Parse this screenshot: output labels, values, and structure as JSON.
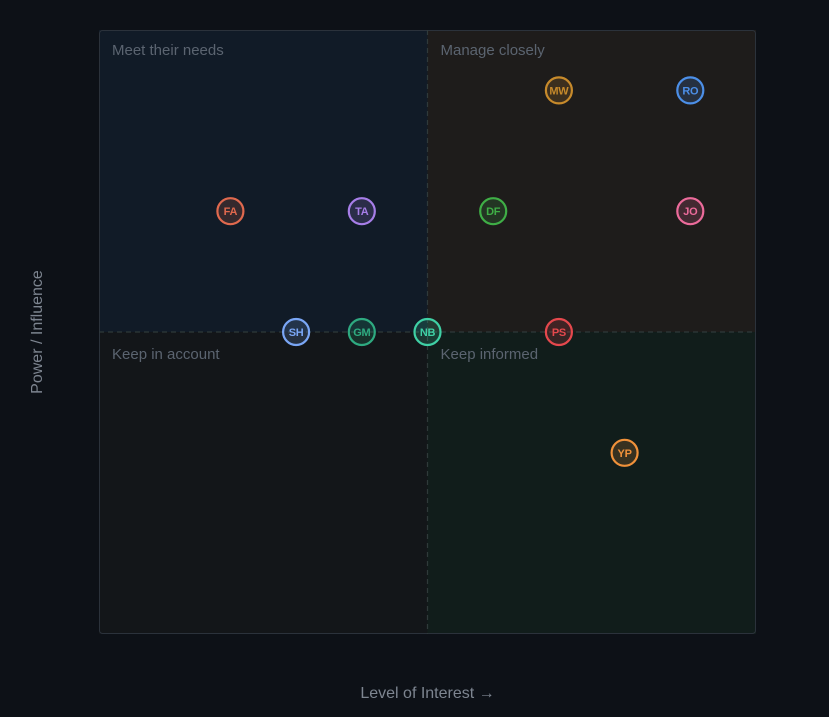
{
  "chart_data": {
    "type": "scatter",
    "xlabel": "Level of Interest →",
    "ylabel": "Power / Influence",
    "xlim": [
      0,
      5
    ],
    "ylim": [
      0,
      5
    ],
    "quadrants": {
      "top_left": {
        "label": "Meet their needs",
        "fill": "#111b27"
      },
      "top_right": {
        "label": "Manage closely",
        "fill": "#1e1c1b"
      },
      "bottom_left": {
        "label": "Keep in account",
        "fill": "#131619"
      },
      "bottom_right": {
        "label": "Keep informed",
        "fill": "#111d1b"
      }
    },
    "points": [
      {
        "initials": "MW",
        "x": 3.5,
        "y": 4.5,
        "color": "#c78a2b"
      },
      {
        "initials": "RO",
        "x": 4.5,
        "y": 4.5,
        "color": "#4c8fe8"
      },
      {
        "initials": "FA",
        "x": 1.0,
        "y": 3.5,
        "color": "#e0694e"
      },
      {
        "initials": "TA",
        "x": 2.0,
        "y": 3.5,
        "color": "#a77ee8"
      },
      {
        "initials": "DF",
        "x": 3.0,
        "y": 3.5,
        "color": "#3fae46"
      },
      {
        "initials": "JO",
        "x": 4.5,
        "y": 3.5,
        "color": "#ec6b9b"
      },
      {
        "initials": "SH",
        "x": 1.5,
        "y": 2.5,
        "color": "#7aa6f5"
      },
      {
        "initials": "GM",
        "x": 2.0,
        "y": 2.5,
        "color": "#2eaa80"
      },
      {
        "initials": "NB",
        "x": 2.5,
        "y": 2.5,
        "color": "#3fd0a5"
      },
      {
        "initials": "PS",
        "x": 3.5,
        "y": 2.5,
        "color": "#e5484d"
      },
      {
        "initials": "YP",
        "x": 4.0,
        "y": 1.5,
        "color": "#f0913a"
      }
    ]
  }
}
